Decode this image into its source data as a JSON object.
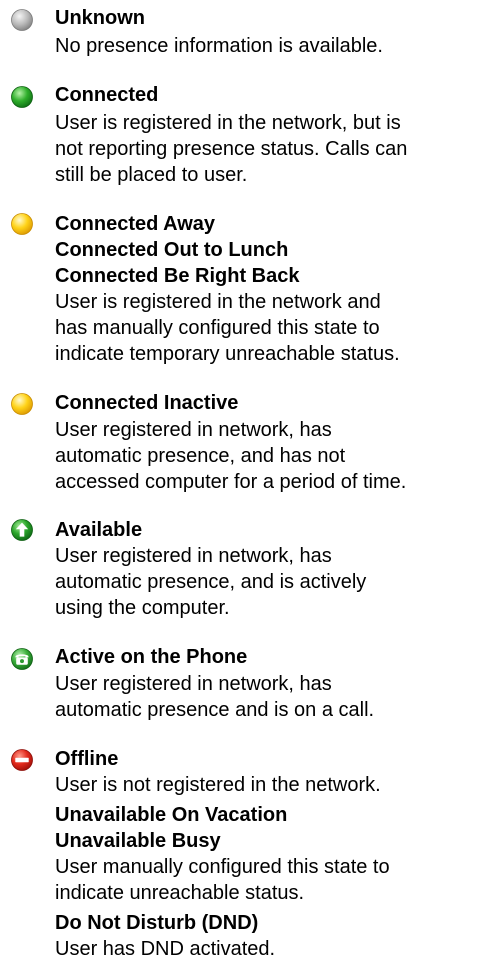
{
  "entries": [
    {
      "icon": "gray-circle-icon",
      "titles": [
        "Unknown"
      ],
      "description": [
        "No presence information is available."
      ]
    },
    {
      "icon": "green-circle-icon",
      "titles": [
        "Connected"
      ],
      "description": [
        "User is registered in the network, but is",
        "not reporting presence status. Calls can",
        "still be placed to user."
      ]
    },
    {
      "icon": "yellow-circle-icon",
      "titles": [
        "Connected Away",
        "Connected Out to Lunch",
        "Connected Be Right Back"
      ],
      "description": [
        "User is registered in the network and",
        "has manually configured this state to",
        "indicate temporary unreachable status."
      ]
    },
    {
      "icon": "yellow-circle-icon",
      "titles": [
        "Connected Inactive"
      ],
      "description": [
        "User registered in network, has",
        "automatic presence, and has not",
        "accessed computer for a period of time."
      ]
    },
    {
      "icon": "green-up-arrow-icon",
      "titles": [
        "Available"
      ],
      "description": [
        "User registered in network, has",
        "automatic presence, and is actively",
        "using the computer."
      ]
    },
    {
      "icon": "phone-icon",
      "titles": [
        "Active on the Phone"
      ],
      "description": [
        "User registered in network, has",
        "automatic presence and is on a call."
      ]
    },
    {
      "icon": "red-no-entry-icon",
      "titles": [
        "Offline"
      ],
      "description": [
        "User is not registered in the network."
      ]
    },
    {
      "icon": "",
      "titles": [
        "Unavailable On Vacation",
        "Unavailable Busy"
      ],
      "description": [
        "User manually configured this state to",
        "indicate unreachable status."
      ]
    },
    {
      "icon": "",
      "titles": [
        "Do Not Disturb (DND)"
      ],
      "description": [
        "User has DND activated."
      ]
    }
  ]
}
